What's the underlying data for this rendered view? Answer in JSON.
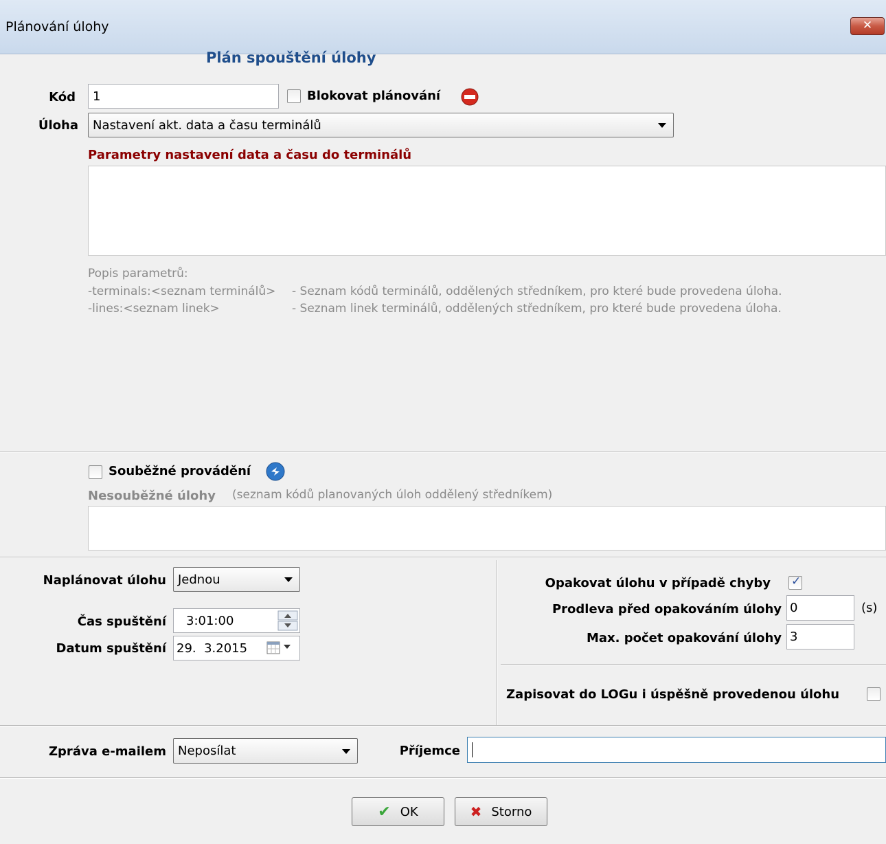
{
  "window": {
    "title": "Plánování úlohy",
    "close_label": "✕"
  },
  "header": {
    "title": "Plán spouštění úlohy"
  },
  "form": {
    "kod_label": "Kód",
    "kod_value": "1",
    "block_label": "Blokovat plánování",
    "task_label": "Úloha",
    "task_value": "Nastavení akt. data a času terminálů",
    "params_title": "Parametry nastavení data a času do terminálů",
    "params_value": "",
    "params_desc_title": "Popis parametrů:",
    "param1_name": "-terminals:<seznam terminálů>",
    "param1_desc": "- Seznam kódů terminálů, oddělených středníkem, pro které bude provedena úloha.",
    "param2_name": "-lines:<seznam linek>",
    "param2_desc": "- Seznam linek terminálů, oddělených středníkem, pro které bude provedena úloha.",
    "concurrent_label": "Souběžné provádění",
    "nonconcurrent_label": "Nesouběžné úlohy",
    "nonconcurrent_hint": "(seznam kódů planovaných úloh oddělený středníkem)",
    "nonconcurrent_value": ""
  },
  "schedule": {
    "plan_label": "Naplánovat úlohu",
    "plan_value": "Jednou",
    "time_label": "Čas spuštění",
    "time_value": "3:01:00",
    "date_label": "Datum spuštění",
    "date_value": "29.  3.2015"
  },
  "retry": {
    "repeat_label": "Opakovat úlohu v případě chyby",
    "repeat_checked": true,
    "delay_label": "Prodleva před opakováním úlohy",
    "delay_value": "0",
    "delay_unit": "(s)",
    "max_label": "Max. počet opakování úlohy",
    "max_value": "3",
    "log_label": "Zapisovat do LOGu i úspěšně provedenou úlohu",
    "log_checked": false
  },
  "email": {
    "label": "Zpráva e-mailem",
    "value": "Neposílat",
    "recipient_label": "Příjemce",
    "recipient_value": ""
  },
  "buttons": {
    "ok_label": "OK",
    "cancel_label": "Storno"
  },
  "colors": {
    "header_blue": "#1f4e8c",
    "params_red": "#8b0000",
    "ok_green": "#3aa63a",
    "cancel_red": "#cc1f1f"
  }
}
